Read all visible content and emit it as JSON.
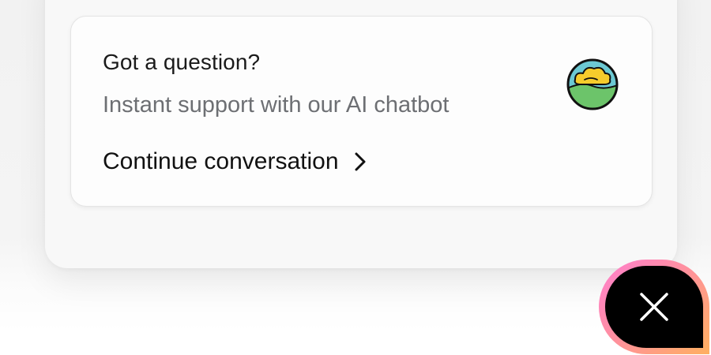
{
  "support_card": {
    "title": "Got a question?",
    "subtitle": "Instant support with our AI chatbot",
    "action_label": "Continue conversation",
    "action_icon": "chevron-right-icon",
    "avatar_icon": "landscape-cloud-avatar-icon"
  },
  "launcher": {
    "icon": "close-icon",
    "colors": {
      "background": "#000000",
      "ring_start": "#ff7fd0",
      "ring_end": "#ffb060"
    }
  }
}
